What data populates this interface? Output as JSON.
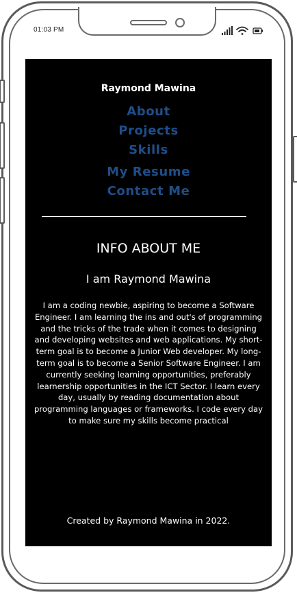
{
  "status_bar": {
    "time": "01:03 PM",
    "icons": [
      "signal-icon",
      "wifi-icon",
      "battery-icon"
    ]
  },
  "site": {
    "title": "Raymond Mawina"
  },
  "nav": {
    "items": [
      {
        "label": "About"
      },
      {
        "label": "Projects"
      },
      {
        "label": "Skills"
      },
      {
        "label": "My Resume"
      },
      {
        "label": "Contact Me"
      }
    ]
  },
  "about": {
    "heading": "INFO ABOUT ME",
    "subheading": "I am Raymond Mawina",
    "bio": "I am a coding newbie, aspiring to become a Software Engineer. I am learning the ins and out's of programming and the tricks of the trade when it comes to designing and developing websites and web applications. My short-term goal is to become a Junior Web developer. My long-term goal is to become a Senior Software Engineer. I am currently seeking learning opportunities, preferably learnership opportunities in the ICT Sector. I learn every day, usually by reading documentation about programming languages or frameworks. I code every day to make sure my skills become practical"
  },
  "footer": {
    "text": "Created by Raymond Mawina in 2022."
  },
  "colors": {
    "background": "#000000",
    "nav_link": "#1f4e89",
    "text": "#ffffff",
    "device_frame": "#5a5a5a"
  }
}
